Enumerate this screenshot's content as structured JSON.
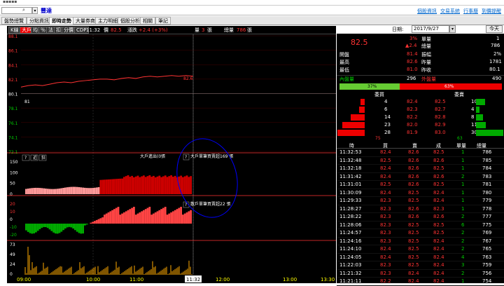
{
  "symbol": {
    "name": "豐達"
  },
  "top_links": [
    "個股資訊",
    "交易系統",
    "行事曆",
    "到價提醒"
  ],
  "tabs": [
    "盤勢總覽",
    "分點資訊",
    "即時走勢",
    "大量券商",
    "主力明細",
    "個股分析",
    "相關",
    "筆記"
  ],
  "active_tab": 2,
  "toolbar": {
    "buttons": [
      "K線",
      "大戶",
      "均",
      "％",
      "法",
      "扣",
      "分價",
      "CDP"
    ],
    "time": "11:32",
    "price_label": "價",
    "price": "82.5",
    "change_label": "漲跌",
    "change": "+2.4 (+3%)",
    "vol_label": "量",
    "vol": "3",
    "vol_unit": "張",
    "total_label": "總量",
    "total": "786",
    "total_unit": "張"
  },
  "date": {
    "label": "日期:",
    "value": "2017/9/27",
    "today": "今天"
  },
  "chart_data": {
    "type": "line",
    "price_ticks": [
      "88.1",
      "86.1",
      "84.1",
      "82.1",
      "80.1",
      "78.1",
      "76.1",
      "74.1",
      "72.1"
    ],
    "price_start_label": "81",
    "price_end_label": "82.6",
    "x_ticks": [
      "09:00",
      "10:00",
      "11:00",
      "11:32",
      "12:00",
      "13:00",
      "13:30"
    ],
    "big_ticks": [
      "150",
      "100",
      "50",
      "0"
    ],
    "net_ticks": [
      "20",
      "10",
      "0",
      "-10",
      "-20"
    ],
    "vol_ticks": [
      "73",
      "49",
      "24",
      "0"
    ],
    "big_panel_buttons": [
      "?",
      "近",
      "狂"
    ],
    "annotations": [
      "大戶進出(0張",
      "大戶單筆買賣超169 張",
      "散戶單筆買賣超22 張"
    ],
    "price_series": [
      81,
      81.2,
      81.3,
      81.2,
      81.4,
      81.6,
      81.7,
      81.6,
      81.8,
      81.9,
      82.0,
      82.1,
      82.1,
      82.0,
      82.2,
      82.3,
      82.2,
      82.4,
      82.5,
      82.4,
      82.5,
      82.6,
      82.5,
      82.6,
      82.5
    ]
  },
  "quote": {
    "price": "82.5",
    "pct": "3%",
    "chg": "▲2.4",
    "unit_label": "單量",
    "unit": "1",
    "total_label": "總量",
    "total": "786",
    "open_label": "開盤",
    "open": "81.4",
    "amp_label": "振幅",
    "amp": "2%",
    "high_label": "最高",
    "high": "82.6",
    "prev_vol_label": "昨量",
    "prev_vol": "1781",
    "low_label": "最低",
    "low": "81.0",
    "prev_close_label": "昨收",
    "prev_close": "80.1",
    "inner_label": "內盤量",
    "inner": "296",
    "outer_label": "外盤量",
    "outer": "490",
    "inner_pct": "37%",
    "outer_pct": "63%",
    "bid_header": "委買",
    "ask_header": "委賣"
  },
  "book": [
    {
      "bq": "4",
      "bp": "82.4",
      "ap": "82.5",
      "aq": "10"
    },
    {
      "bq": "6",
      "bp": "82.3",
      "ap": "82.7",
      "aq": "4"
    },
    {
      "bq": "14",
      "bp": "82.2",
      "ap": "82.8",
      "aq": "8"
    },
    {
      "bq": "23",
      "bp": "82.0",
      "ap": "82.9",
      "aq": "11"
    },
    {
      "bq": "28",
      "bp": "81.9",
      "ap": "83.0",
      "aq": "30"
    }
  ],
  "book_totals": {
    "bid": "75",
    "ask": "63"
  },
  "trade_headers": [
    "時",
    "買",
    "賣",
    "成",
    "單量",
    "總量"
  ],
  "trades": [
    [
      "11:32:53",
      "82.4",
      "82.6",
      "82.5",
      "1",
      "786"
    ],
    [
      "11:32:48",
      "82.5",
      "82.6",
      "82.6",
      "1",
      "785"
    ],
    [
      "11:32:18",
      "82.4",
      "82.6",
      "82.5",
      "1",
      "784"
    ],
    [
      "11:31:42",
      "82.4",
      "82.6",
      "82.6",
      "2",
      "783"
    ],
    [
      "11:31:01",
      "82.5",
      "82.6",
      "82.5",
      "1",
      "781"
    ],
    [
      "11:30:09",
      "82.4",
      "82.5",
      "82.4",
      "1",
      "780"
    ],
    [
      "11:29:33",
      "82.3",
      "82.5",
      "82.4",
      "1",
      "779"
    ],
    [
      "11:28:27",
      "82.3",
      "82.6",
      "82.3",
      "1",
      "778"
    ],
    [
      "11:28:22",
      "82.3",
      "82.6",
      "82.6",
      "2",
      "777"
    ],
    [
      "11:28:06",
      "82.3",
      "82.5",
      "82.5",
      "6",
      "775"
    ],
    [
      "11:24:57",
      "82.3",
      "82.5",
      "82.5",
      "2",
      "769"
    ],
    [
      "11:24:16",
      "82.3",
      "82.5",
      "82.4",
      "2",
      "767"
    ],
    [
      "11:24:10",
      "82.4",
      "82.5",
      "82.4",
      "2",
      "765"
    ],
    [
      "11:24:05",
      "82.4",
      "82.5",
      "82.4",
      "4",
      "763"
    ],
    [
      "11:22:03",
      "82.3",
      "82.5",
      "82.4",
      "3",
      "759"
    ],
    [
      "11:21:32",
      "82.3",
      "82.4",
      "82.4",
      "2",
      "756"
    ],
    [
      "11:21:11",
      "82.2",
      "82.4",
      "82.4",
      "1",
      "754"
    ]
  ]
}
